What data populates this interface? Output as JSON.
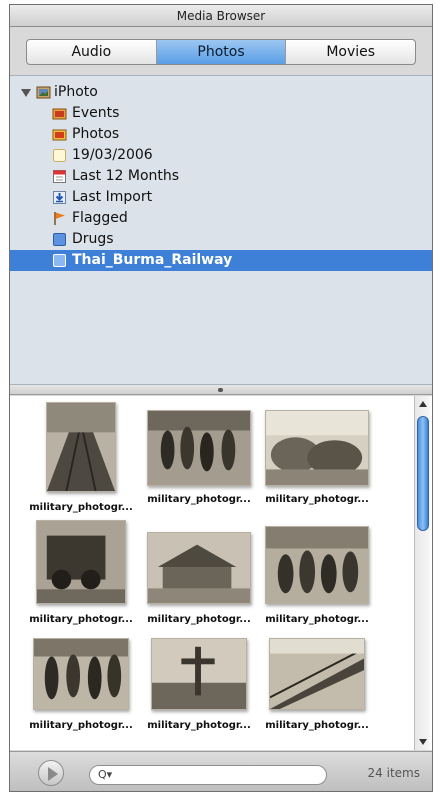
{
  "window": {
    "title": "Media Browser"
  },
  "tabs": [
    {
      "label": "Audio",
      "active": false
    },
    {
      "label": "Photos",
      "active": true
    },
    {
      "label": "Movies",
      "active": false
    }
  ],
  "source_list": {
    "root": {
      "label": "iPhoto",
      "icon": "iphoto-icon",
      "expanded": true
    },
    "items": [
      {
        "label": "Events",
        "icon": "events-icon"
      },
      {
        "label": "Photos",
        "icon": "photos-icon"
      },
      {
        "label": "19/03/2006",
        "icon": "album-icon"
      },
      {
        "label": "Last 12 Months",
        "icon": "calendar-icon"
      },
      {
        "label": "Last Import",
        "icon": "import-icon"
      },
      {
        "label": "Flagged",
        "icon": "flag-icon"
      },
      {
        "label": "Drugs",
        "icon": "album-icon"
      },
      {
        "label": "Thai_Burma_Railway",
        "icon": "album-icon",
        "selected": true
      }
    ]
  },
  "photos": [
    {
      "caption": "military_photogr..."
    },
    {
      "caption": "military_photogr..."
    },
    {
      "caption": "military_photogr..."
    },
    {
      "caption": "military_photogr..."
    },
    {
      "caption": "military_photogr..."
    },
    {
      "caption": "military_photogr..."
    },
    {
      "caption": "military_photogr..."
    },
    {
      "caption": "military_photogr..."
    },
    {
      "caption": "military_photogr..."
    }
  ],
  "footer": {
    "search_value": "",
    "search_icon": "Q▾",
    "item_count": "24 items"
  },
  "colors": {
    "selection": "#3e7fd8",
    "active_tab": "#5a9ee6",
    "source_bg": "#dbe2ea"
  }
}
